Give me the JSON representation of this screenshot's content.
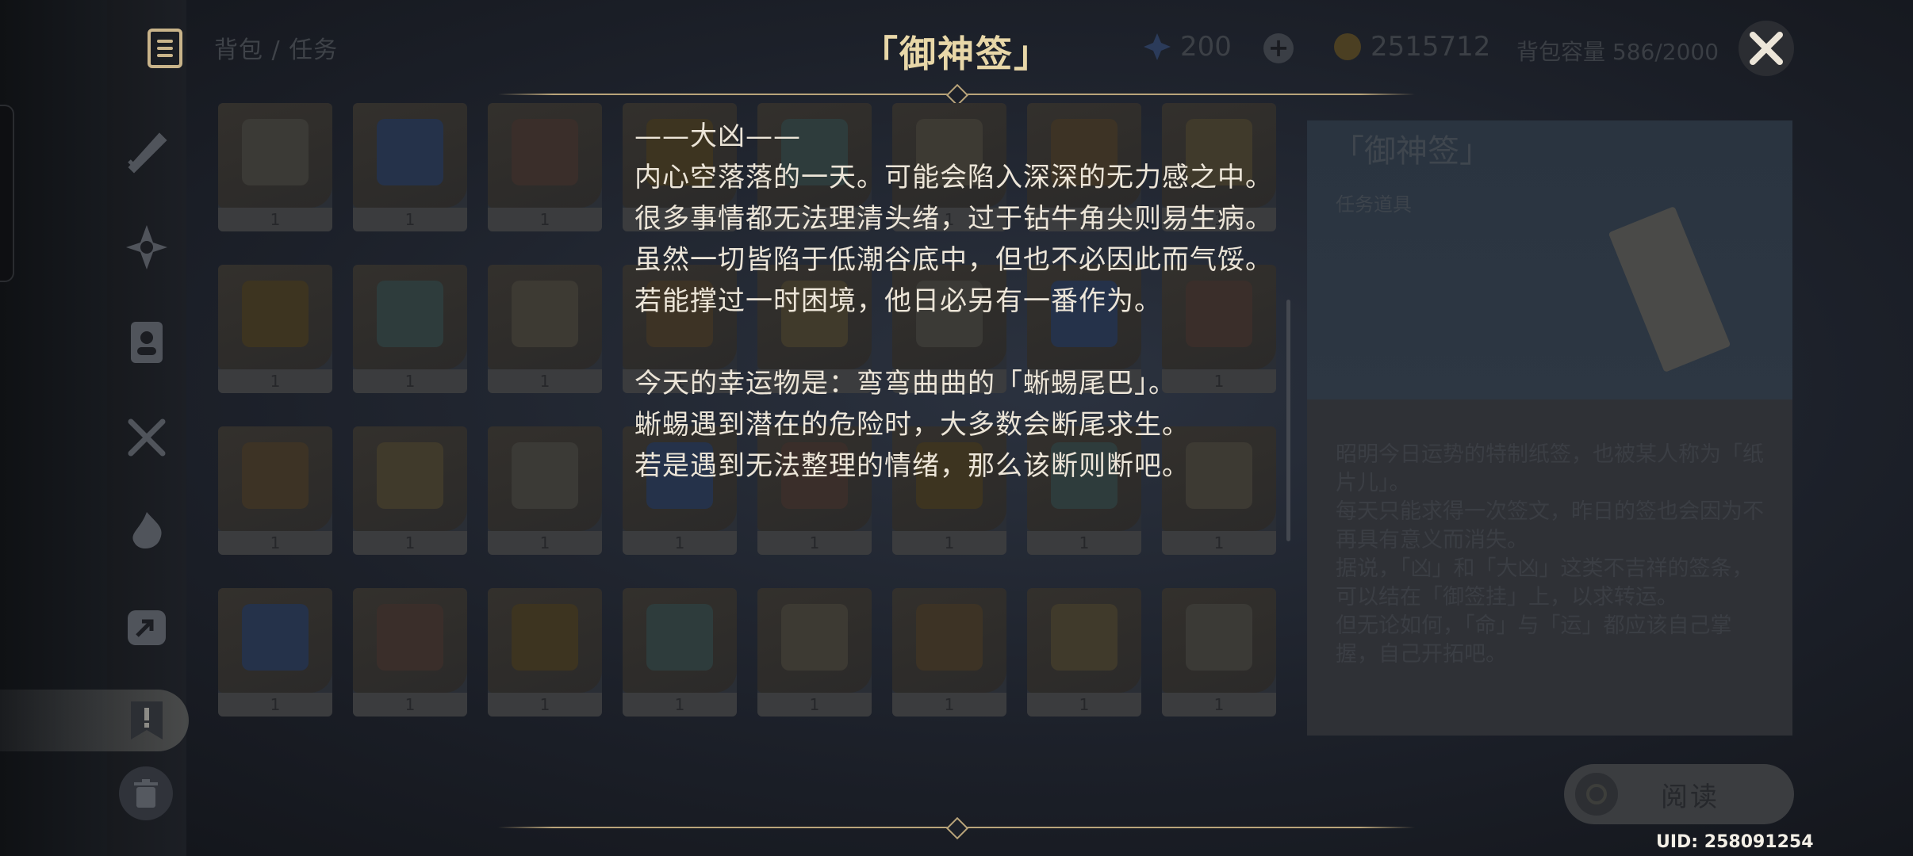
{
  "header": {
    "breadcrumb": "背包 / 任务",
    "title": "「御神签」",
    "primogems": "200",
    "mora": "2515712",
    "capacity": "背包容量 586/2000"
  },
  "grid": {
    "counts": [
      "1",
      "1",
      "1",
      "1",
      "1",
      "1",
      "1",
      "1",
      "1",
      "1",
      "1",
      "1",
      "1",
      "1",
      "1",
      "1",
      "1",
      "1",
      "1",
      "1",
      "1",
      "1",
      "1",
      "1",
      "1",
      "1",
      "1",
      "1",
      "1",
      "1",
      "1",
      "1"
    ]
  },
  "fortune": {
    "lines": [
      "——大凶——",
      "内心空落落的一天。可能会陷入深深的无力感之中。",
      "很多事情都无法理清头绪，过于钻牛角尖则易生病。",
      "虽然一切皆陷于低潮谷底中，但也不必因此而气馁。",
      "若能撑过一时困境，他日必另有一番作为。",
      "今天的幸运物是：弯弯曲曲的「蜥蜴尾巴」。",
      "蜥蜴遇到潜在的危险时，大多数会断尾求生。",
      "若是遇到无法整理的情绪，那么该断则断吧。"
    ]
  },
  "detail": {
    "name": "「御神签」",
    "type": "任务道具",
    "description": [
      "昭明今日运势的特制纸签，也被某人称为「纸片儿」。",
      "每天只能求得一次签文，昨日的签也会因为不再具有意义而消失。",
      "据说，「凶」和「大凶」这类不吉祥的签条，可以结在「御签挂」上，以求转运。",
      "但无论如何，「命」与「运」都应该自己掌握，自己开拓吧。"
    ],
    "read_button": "阅读"
  },
  "footer": {
    "uid": "UID: 258091254"
  },
  "colors": {
    "accent_gold": "#e8d7a8",
    "text_light": "#ece5d8",
    "deco_line": "#b9a47a"
  },
  "icons": [
    "document-icon",
    "sword-icon",
    "artifact-icon",
    "character-icon",
    "food-icon",
    "material-icon",
    "gadget-icon",
    "quest-icon",
    "trash-icon",
    "primogem-icon",
    "mora-icon",
    "plus-icon",
    "close-icon"
  ]
}
